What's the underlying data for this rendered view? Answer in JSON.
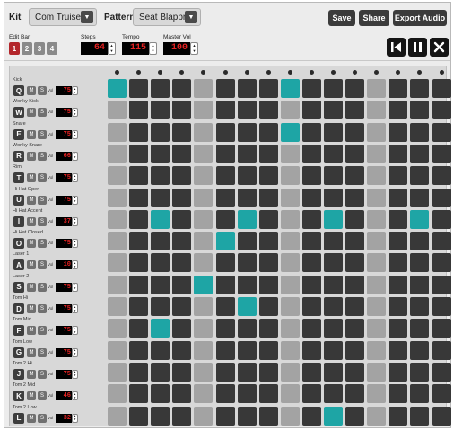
{
  "header": {
    "kit_label": "Kit",
    "kit_value": "Com Truise",
    "pattern_label": "Pattern",
    "pattern_value": "Seat Blappr",
    "dropdown_icon": "chevron-down-icon",
    "save_label": "Save",
    "share_label": "Share",
    "export_label": "Export Audio"
  },
  "controls": {
    "edit_bar_label": "Edit Bar",
    "bars": [
      "1",
      "2",
      "3",
      "4"
    ],
    "active_bar": "1",
    "steps_label": "Steps",
    "steps_value": "64",
    "tempo_label": "Tempo",
    "tempo_value": "115",
    "master_vol_label": "Master Vol",
    "master_vol_value": "100",
    "transport_icons": [
      "skip-back-icon",
      "pause-icon",
      "close-icon"
    ]
  },
  "colors": {
    "active_step": "#1ea5a5",
    "beat_step": "#a3a3a3",
    "inactive_step": "#383838",
    "led_text": "#e42222",
    "active_bar": "#b3262b"
  },
  "grid": {
    "mute_label": "M",
    "solo_label": "S",
    "vol_label": "Vol",
    "playhead_markers": 16,
    "beat_steps": [
      0,
      4,
      8,
      12
    ],
    "tracks": [
      {
        "name": "Kick",
        "key": "Q",
        "vol": "75",
        "active": [
          0,
          8
        ]
      },
      {
        "name": "Wonky Kick",
        "key": "W",
        "vol": "75",
        "active": []
      },
      {
        "name": "Snare",
        "key": "E",
        "vol": "75",
        "active": [
          8
        ]
      },
      {
        "name": "Wonky Snare",
        "key": "R",
        "vol": "66",
        "active": []
      },
      {
        "name": "Rim",
        "key": "T",
        "vol": "75",
        "active": []
      },
      {
        "name": "Hi Hat Open",
        "key": "U",
        "vol": "75",
        "active": []
      },
      {
        "name": "Hi Hat Accent",
        "key": "I",
        "vol": "37",
        "active": [
          2,
          6,
          10,
          14
        ]
      },
      {
        "name": "Hi Hat Closed",
        "key": "O",
        "vol": "75",
        "active": [
          5
        ]
      },
      {
        "name": "Laser 1",
        "key": "A",
        "vol": "10",
        "active": []
      },
      {
        "name": "Laser 2",
        "key": "S",
        "vol": "75",
        "active": [
          4
        ]
      },
      {
        "name": "Tom Hi",
        "key": "D",
        "vol": "75",
        "active": [
          6
        ]
      },
      {
        "name": "Tom Mid",
        "key": "F",
        "vol": "75",
        "active": [
          2
        ]
      },
      {
        "name": "Tom Low",
        "key": "G",
        "vol": "75",
        "active": []
      },
      {
        "name": "Tom 2 Hi",
        "key": "J",
        "vol": "75",
        "active": []
      },
      {
        "name": "Tom 2 Mid",
        "key": "K",
        "vol": "46",
        "active": []
      },
      {
        "name": "Tom 2 Low",
        "key": "L",
        "vol": "32",
        "active": [
          10
        ]
      }
    ]
  }
}
